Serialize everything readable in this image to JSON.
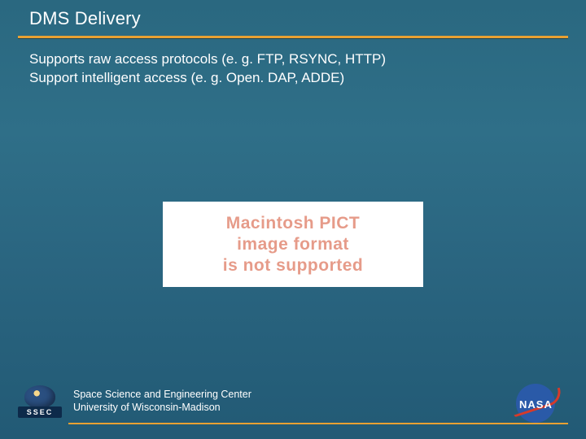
{
  "title": "DMS Delivery",
  "body": {
    "line1": "Supports raw access protocols (e. g. FTP, RSYNC, HTTP)",
    "line2": "Support intelligent access (e. g. Open. DAP, ADDE)"
  },
  "pict": {
    "line1": "Macintosh PICT",
    "line2": "image format",
    "line3": "is not supported"
  },
  "footer": {
    "org1": "Space Science and Engineering Center",
    "org2": "University of Wisconsin-Madison",
    "ssec_label": "SSEC",
    "nasa_label": "NASA"
  }
}
